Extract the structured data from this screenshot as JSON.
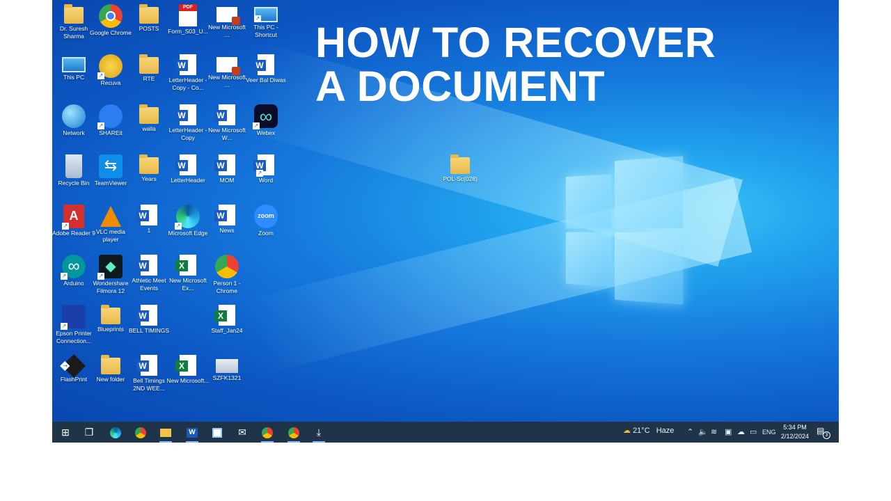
{
  "headline": {
    "line1": "HOW TO RECOVER",
    "line2": "A DOCUMENT"
  },
  "desktop_icons": [
    {
      "label": "Dr. Suresh Sharma",
      "icon": "user-folder-icon"
    },
    {
      "label": "Google Chrome",
      "icon": "chrome-icon"
    },
    {
      "label": "POSTS",
      "icon": "folder-icon"
    },
    {
      "label": "Form_S03_U...",
      "icon": "pdf-icon"
    },
    {
      "label": "New Microsoft ...",
      "icon": "powerpoint-icon"
    },
    {
      "label": "This PC - Shortcut",
      "icon": "computer-icon"
    },
    {
      "label": "This PC",
      "icon": "computer-icon"
    },
    {
      "label": "Recuva",
      "icon": "recuva-icon"
    },
    {
      "label": "RTE",
      "icon": "folder-icon"
    },
    {
      "label": "LetterHeader - Copy - Co...",
      "icon": "word-icon"
    },
    {
      "label": "New Microsoft ...",
      "icon": "powerpoint-icon"
    },
    {
      "label": "Veer Bal Diwas",
      "icon": "word-icon"
    },
    {
      "label": "Network",
      "icon": "network-icon"
    },
    {
      "label": "SHAREit",
      "icon": "shareit-icon"
    },
    {
      "label": "walla",
      "icon": "folder-icon"
    },
    {
      "label": "LetterHeader - Copy",
      "icon": "word-icon"
    },
    {
      "label": "New Microsoft W...",
      "icon": "word-icon"
    },
    {
      "label": "Webex",
      "icon": "webex-icon"
    },
    {
      "label": "Recycle Bin",
      "icon": "recycle-bin-icon"
    },
    {
      "label": "TeamViewer",
      "icon": "teamviewer-icon"
    },
    {
      "label": "Years",
      "icon": "folder-icon"
    },
    {
      "label": "LetterHeader",
      "icon": "word-icon"
    },
    {
      "label": "MOM",
      "icon": "word-icon"
    },
    {
      "label": "Word",
      "icon": "word-app-icon"
    },
    {
      "label": "Adobe Reader 9",
      "icon": "adobe-reader-icon"
    },
    {
      "label": "VLC media player",
      "icon": "vlc-icon"
    },
    {
      "label": "1",
      "icon": "word-icon"
    },
    {
      "label": "Microsoft Edge",
      "icon": "edge-icon"
    },
    {
      "label": "News",
      "icon": "word-icon"
    },
    {
      "label": "Zoom",
      "icon": "zoom-icon"
    },
    {
      "label": "Arduino",
      "icon": "arduino-icon"
    },
    {
      "label": "Wondershare Filmora 12",
      "icon": "filmora-icon"
    },
    {
      "label": "Athletic Meet Events",
      "icon": "word-icon"
    },
    {
      "label": "New Microsoft Ex...",
      "icon": "excel-icon"
    },
    {
      "label": "Person 1 - Chrome",
      "icon": "chrome-profile-icon"
    },
    {
      "label": "Epson Printer Connection...",
      "icon": "epson-icon"
    },
    {
      "label": "Blueprints",
      "icon": "folder-icon"
    },
    {
      "label": "BELL TIMINGS",
      "icon": "word-icon"
    },
    {
      "label": "Staff_Jan24",
      "icon": "excel-icon"
    },
    {
      "label": "FlashPrint",
      "icon": "flashprint-icon"
    },
    {
      "label": "New folder",
      "icon": "folder-icon"
    },
    {
      "label": "Bell Timings 2ND WEE...",
      "icon": "word-icon"
    },
    {
      "label": "New Microsoft...",
      "icon": "excel-icon"
    },
    {
      "label": "SZFK1321",
      "icon": "file-icon"
    },
    {
      "label": "POL-Sc(028)",
      "icon": "folder-icon"
    }
  ],
  "taskbar": {
    "weather": {
      "temp": "21°C",
      "condition": "Haze"
    },
    "language": "ENG",
    "time": "5:34 PM",
    "date": "2/12/2024",
    "notifications": "3"
  }
}
